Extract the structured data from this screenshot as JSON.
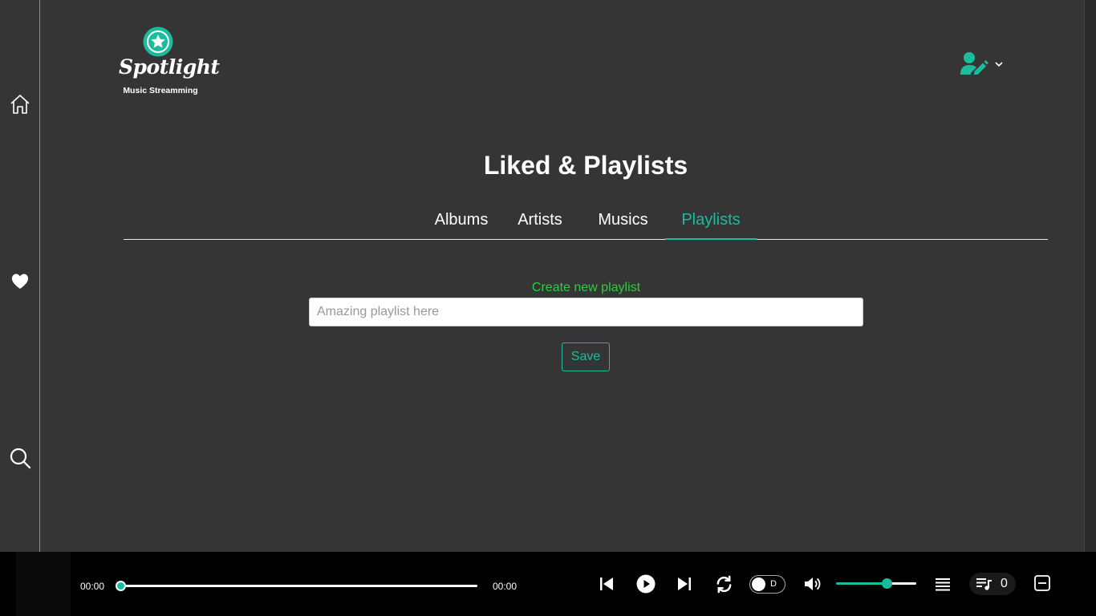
{
  "brand": {
    "name": "Spotlight",
    "tagline": "Music Streamming",
    "accent": "#1abc9c",
    "highlight": "#2ecc40"
  },
  "sidebar": {
    "items": [
      {
        "icon": "home-icon"
      },
      {
        "icon": "heart-icon"
      },
      {
        "icon": "search-icon"
      }
    ]
  },
  "header": {
    "user_icon": "user-edit-icon",
    "menu_icon": "chevron-down-icon"
  },
  "page": {
    "title": "Liked & Playlists"
  },
  "tabs": [
    {
      "label": "Albums",
      "active": false
    },
    {
      "label": "Artists",
      "active": false
    },
    {
      "label": "Musics",
      "active": false
    },
    {
      "label": "Playlists",
      "active": true
    }
  ],
  "create_playlist": {
    "label": "Create new playlist",
    "placeholder": "Amazing playlist here",
    "value": "",
    "save_label": "Save"
  },
  "player": {
    "current_time": "00:00",
    "total_time": "00:00",
    "progress": 0,
    "toggle_label": "D",
    "toggle_on": false,
    "volume": 0.63,
    "queue_count": "0"
  }
}
